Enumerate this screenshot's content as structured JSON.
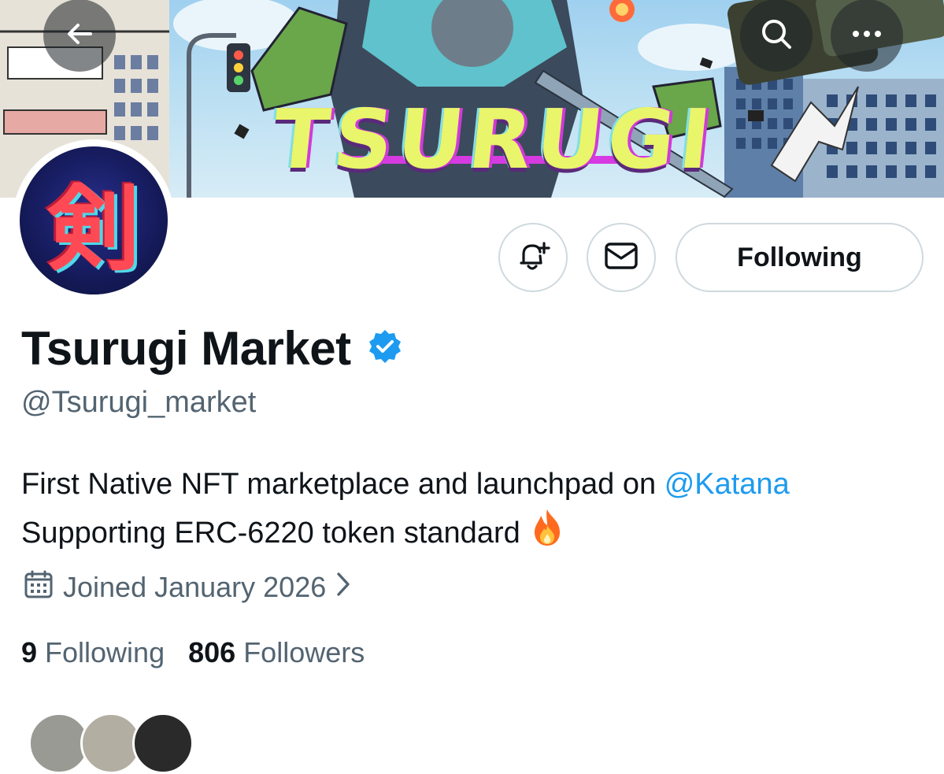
{
  "banner": {
    "title_art": "TSURUGI"
  },
  "nav": {
    "back_icon": "arrow-left-icon",
    "search_icon": "search-icon",
    "more_icon": "more-horizontal-icon"
  },
  "avatar": {
    "glyph": "剣"
  },
  "actions": {
    "notify_icon": "bell-plus-icon",
    "message_icon": "envelope-icon",
    "following_label": "Following"
  },
  "profile": {
    "display_name": "Tsurugi Market",
    "verified_icon": "verified-badge-icon",
    "handle": "@Tsurugi_market",
    "bio_line1_text": "First Native NFT marketplace and launchpad on ",
    "bio_mention": "@Katana",
    "bio_line2_text": "Supporting ERC-6220 token standard",
    "bio_emoji_icon": "fire-icon",
    "joined": "Joined January 2026"
  },
  "stats": {
    "following_count": "9",
    "following_label": "Following",
    "followers_count": "806",
    "followers_label": "Followers"
  },
  "colors": {
    "accent": "#1d9bf0",
    "secondary_text": "#536471",
    "border": "#cfd9de"
  }
}
